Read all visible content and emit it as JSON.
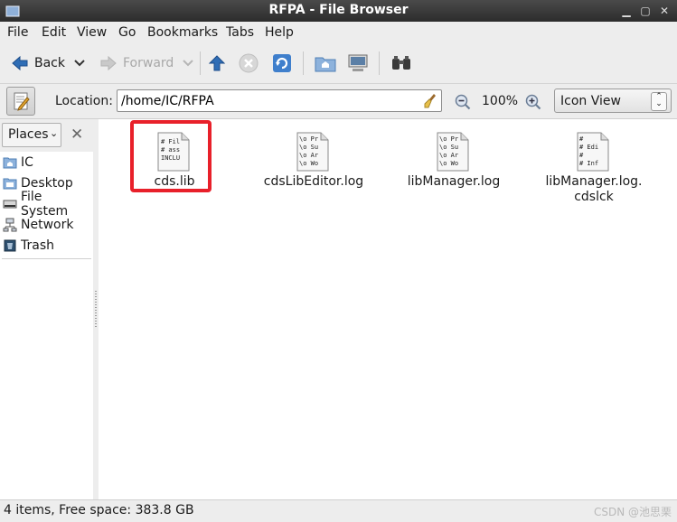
{
  "window": {
    "title": "RFPA - File Browser"
  },
  "menubar": [
    "File",
    "Edit",
    "View",
    "Go",
    "Bookmarks",
    "Tabs",
    "Help"
  ],
  "toolbar": {
    "back": "Back",
    "forward": "Forward"
  },
  "location": {
    "label": "Location:",
    "path": "/home/IC/RFPA",
    "zoom": "100%",
    "view_mode": "Icon View"
  },
  "sidebar": {
    "header": "Places",
    "items": [
      {
        "label": "IC",
        "icon": "home-folder-icon"
      },
      {
        "label": "Desktop",
        "icon": "desktop-folder-icon"
      },
      {
        "label": "File System",
        "icon": "drive-icon"
      },
      {
        "label": "Network",
        "icon": "network-icon"
      },
      {
        "label": "Trash",
        "icon": "trash-icon"
      }
    ]
  },
  "files": [
    {
      "name": "cds.lib",
      "preview": [
        "# Fil",
        "# ass",
        "INCLU"
      ]
    },
    {
      "name": "cdsLibEditor.log",
      "preview": [
        "\\o Pr",
        "\\o Su",
        "\\o Ar",
        "\\o Wo"
      ]
    },
    {
      "name": "libManager.log",
      "preview": [
        "\\o Pr",
        "\\o Su",
        "\\o Ar",
        "\\o Wo"
      ]
    },
    {
      "name": "libManager.log.\ncdslck",
      "preview": [
        "#",
        "# Edi",
        "#",
        "# Inf"
      ]
    }
  ],
  "status": {
    "text": "4 items, Free space: 383.8 GB",
    "watermark": "CSDN @池思栗"
  },
  "colors": {
    "highlight": "#e8202a",
    "titlebar": "#3a3a3a",
    "chrome": "#ededed"
  }
}
